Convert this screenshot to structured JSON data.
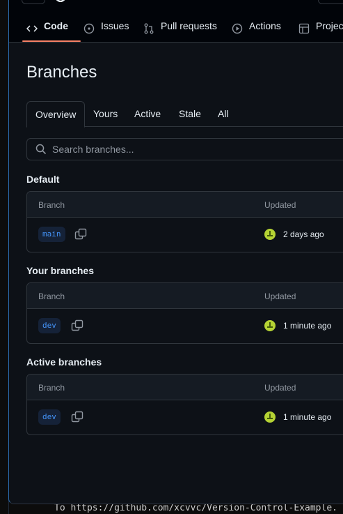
{
  "nav": {
    "tabs": [
      {
        "label": "Code",
        "icon": "code-icon",
        "active": true
      },
      {
        "label": "Issues",
        "icon": "issue-opened-icon",
        "active": false
      },
      {
        "label": "Pull requests",
        "icon": "git-pull-request-icon",
        "active": false
      },
      {
        "label": "Actions",
        "icon": "play-icon",
        "active": false
      },
      {
        "label": "Projec",
        "icon": "table-icon",
        "active": false
      }
    ],
    "active_underline_color": "#f78166"
  },
  "page": {
    "title": "Branches",
    "tabs": [
      "Overview",
      "Yours",
      "Active",
      "Stale",
      "All"
    ],
    "selected_tab": "Overview",
    "search_placeholder": "Search branches..."
  },
  "sections": [
    {
      "title": "Default",
      "col_branch": "Branch",
      "col_updated": "Updated",
      "rows": [
        {
          "branch": "main",
          "updated": "2 days ago"
        }
      ]
    },
    {
      "title": "Your branches",
      "col_branch": "Branch",
      "col_updated": "Updated",
      "rows": [
        {
          "branch": "dev",
          "updated": "1 minute ago"
        }
      ]
    },
    {
      "title": "Active branches",
      "col_branch": "Branch",
      "col_updated": "Updated",
      "rows": [
        {
          "branch": "dev",
          "updated": "1 minute ago"
        }
      ]
    }
  ],
  "terminal": {
    "line": "To https://github.com/xcvvc/Version-Control-Example."
  },
  "colors": {
    "background": "#0d1117",
    "header_background": "#010409",
    "link": "#4493f8",
    "avatar": "#b5d334"
  }
}
